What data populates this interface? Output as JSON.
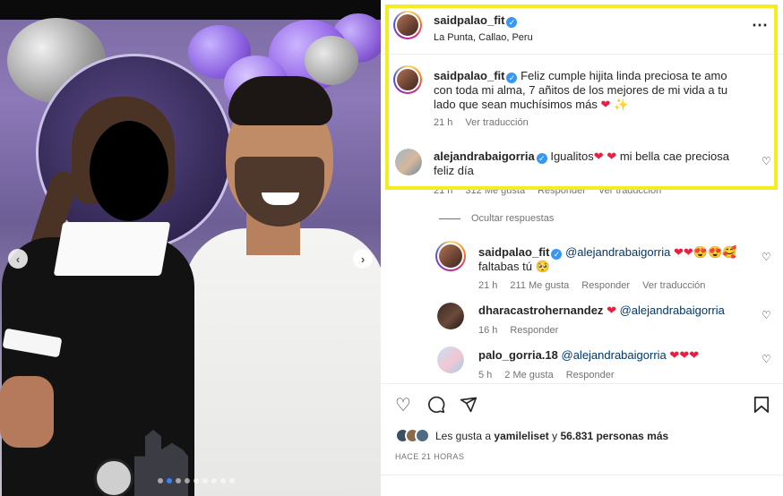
{
  "post": {
    "author": "saidpalao_fit",
    "location": "La Punta, Callao, Peru",
    "more_icon": "⋯"
  },
  "photo": {
    "prev_icon": "‹",
    "next_icon": "›",
    "slides_count": 9,
    "active_slide": 1
  },
  "caption": {
    "author": "saidpalao_fit",
    "text": "Feliz cumple hijita linda preciosa te amo con toda mi alma, 7 añitos de los mejores de mi vida a tu lado que sean muchísimos más ❤️ ✨",
    "time": "21 h",
    "translate": "Ver traducción"
  },
  "comments": [
    {
      "author": "alejandrabaigorria",
      "text": "Igualitos❤️ ❤️ mi bella cae preciosa feliz día",
      "time": "21 h",
      "likes": "312 Me gusta",
      "reply": "Responder",
      "translate": "Ver traducción"
    }
  ],
  "hide_replies": "Ocultar respuestas",
  "replies": [
    {
      "author": "saidpalao_fit",
      "mention": "@alejandrabaigorria",
      "text": " ❤️❤️😍😍🥰 faltabas tú 🥺",
      "time": "21 h",
      "likes": "211 Me gusta",
      "reply": "Responder",
      "translate": "Ver traducción"
    },
    {
      "author": "dharacastrohernandez",
      "mention": "@alejandrabaigorria",
      "text": " ❤️ ",
      "time": "16 h",
      "reply": "Responder"
    },
    {
      "author": "palo_gorria.18",
      "mention": "@alejandrabaigorria",
      "text": " ❤️❤️❤️",
      "time": "5 h",
      "likes": "2 Me gusta",
      "reply": "Responder"
    }
  ],
  "actions": {
    "like_icon": "♡",
    "comment_icon": "💬",
    "share_icon": "➤",
    "save_icon": "🔖"
  },
  "likes": {
    "prefix": "Les gusta a ",
    "user": "yamileliset",
    "middle": " y ",
    "count": "56.831 personas más"
  },
  "posted_ago": "HACE 21 HORAS",
  "colors": {
    "highlight": "#f5ee1f",
    "verified": "#3897f0",
    "link": "#00376b",
    "carousel_active": "#2f86ff"
  }
}
